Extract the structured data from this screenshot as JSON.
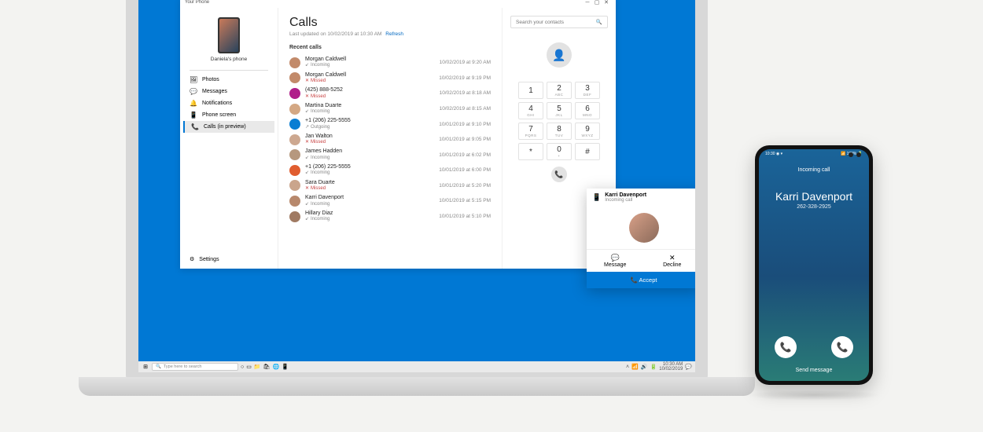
{
  "window": {
    "title": "Your Phone"
  },
  "phone_preview": {
    "label": "Daniela's phone"
  },
  "nav": {
    "items": [
      {
        "icon": "🖼",
        "label": "Photos"
      },
      {
        "icon": "💬",
        "label": "Messages"
      },
      {
        "icon": "🔔",
        "label": "Notifications"
      },
      {
        "icon": "📱",
        "label": "Phone screen"
      },
      {
        "icon": "📞",
        "label": "Calls (in preview)"
      }
    ],
    "settings_label": "Settings"
  },
  "calls": {
    "heading": "Calls",
    "updated": "Last updated on 10/02/2019 at 10:30 AM",
    "refresh": "Refresh",
    "recent_label": "Recent calls",
    "list": [
      {
        "name": "Morgan Caldwell",
        "status": "Incoming",
        "type": "in",
        "time": "10/02/2019 at 9:20 AM",
        "color": "#c28a6a"
      },
      {
        "name": "Morgan Caldwell",
        "status": "Missed",
        "type": "miss",
        "time": "10/02/2019 at 9:19 PM",
        "color": "#c28a6a"
      },
      {
        "name": "(425) 888-5252",
        "status": "Missed",
        "type": "miss",
        "time": "10/02/2019 at 8:18 AM",
        "color": "#b01f8a"
      },
      {
        "name": "Martina Duarte",
        "status": "Incoming",
        "type": "in",
        "time": "10/02/2019 at 8:15 AM",
        "color": "#d4a884"
      },
      {
        "name": "+1 (206) 225-5555",
        "status": "Outgoing",
        "type": "out",
        "time": "10/01/2019 at 9:10 PM",
        "color": "#0a7ed3"
      },
      {
        "name": "Jan Walton",
        "status": "Missed",
        "type": "miss",
        "time": "10/01/2019 at 9:05 PM",
        "color": "#cda890"
      },
      {
        "name": "James Hadden",
        "status": "Incoming",
        "type": "in",
        "time": "10/01/2019 at 6:02 PM",
        "color": "#b6987e"
      },
      {
        "name": "+1 (206) 225-5555",
        "status": "Incoming",
        "type": "in",
        "time": "10/01/2019 at 6:00 PM",
        "color": "#e05d2f"
      },
      {
        "name": "Sara Duarte",
        "status": "Missed",
        "type": "miss",
        "time": "10/01/2019 at 5:20 PM",
        "color": "#caa58c"
      },
      {
        "name": "Karri Davenport",
        "status": "Incoming",
        "type": "in",
        "time": "10/01/2019 at 5:15 PM",
        "color": "#b7886c"
      },
      {
        "name": "Hillary Diaz",
        "status": "Incoming",
        "type": "in",
        "time": "10/01/2019 at 5:10 PM",
        "color": "#a07a62"
      }
    ]
  },
  "dialer": {
    "search_placeholder": "Search your contacts",
    "keys": [
      {
        "n": "1",
        "l": ""
      },
      {
        "n": "2",
        "l": "ABC"
      },
      {
        "n": "3",
        "l": "DEF"
      },
      {
        "n": "4",
        "l": "GHI"
      },
      {
        "n": "5",
        "l": "JKL"
      },
      {
        "n": "6",
        "l": "MNO"
      },
      {
        "n": "7",
        "l": "PQRS"
      },
      {
        "n": "8",
        "l": "TUV"
      },
      {
        "n": "9",
        "l": "WXYZ"
      },
      {
        "n": "*",
        "l": ""
      },
      {
        "n": "0",
        "l": "+"
      },
      {
        "n": "#",
        "l": ""
      }
    ]
  },
  "toast": {
    "caller": "Karri Davenport",
    "sub": "Incoming call",
    "message": "Message",
    "decline": "Decline",
    "accept": "Accept"
  },
  "taskbar": {
    "search": "Type here to search",
    "time": "10:30 AM",
    "date": "10/02/2019"
  },
  "mobile": {
    "status_left": "10:30 ◉ ▾",
    "status_right": "📶 100% 🔋",
    "incoming": "Incoming call",
    "name": "Karri Davenport",
    "number": "262-328-2925",
    "send": "Send message"
  }
}
